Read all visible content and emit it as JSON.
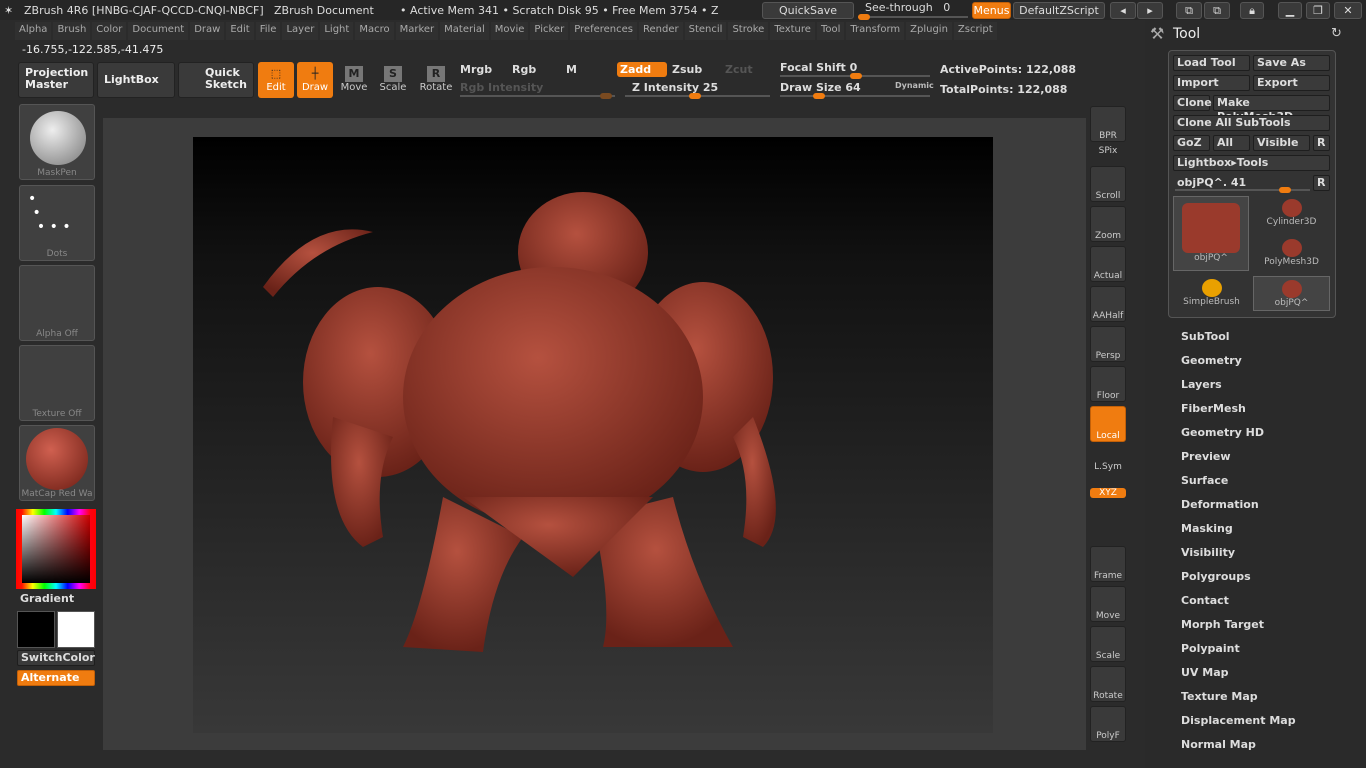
{
  "titlebar": {
    "title": "ZBrush 4R6 [HNBG-CJAF-QCCD-CNQI-NBCF]",
    "document": "ZBrush Document",
    "status": "• Active Mem 341 • Scratch Disk 95 • Free Mem 3754 • Z",
    "quicksave": "QuickSave",
    "see_through_label": "See-through",
    "see_through_value": "0",
    "see_through_level": 0,
    "menus": "Menus",
    "zscript": "DefaultZScript"
  },
  "menu": [
    "Alpha",
    "Brush",
    "Color",
    "Document",
    "Draw",
    "Edit",
    "File",
    "Layer",
    "Light",
    "Macro",
    "Marker",
    "Material",
    "Movie",
    "Picker",
    "Preferences",
    "Render",
    "Stencil",
    "Stroke",
    "Texture",
    "Tool",
    "Transform",
    "Zplugin",
    "Zscript"
  ],
  "coords": "-16.755,-122.585,-41.475",
  "toolbar": {
    "projection_master": "Projection Master",
    "lightbox": "LightBox",
    "quick_sketch": "Quick Sketch",
    "edit": "Edit",
    "draw": "Draw",
    "move": "Move",
    "scale": "Scale",
    "rotate": "Rotate",
    "mrgb": "Mrgb",
    "rgb": "Rgb",
    "m": "M",
    "rgb_intensity": "Rgb Intensity",
    "zadd": "Zadd",
    "zsub": "Zsub",
    "zcut": "Zcut",
    "z_intensity": "Z Intensity 25",
    "focal_shift": "Focal Shift 0",
    "draw_size": "Draw Size 64",
    "dynamic": "Dynamic",
    "active_points": "ActivePoints: 122,088",
    "total_points": "TotalPoints: 122,088"
  },
  "left_shelf": {
    "brush": "MaskPen",
    "stroke": "Dots",
    "alpha": "Alpha Off",
    "texture": "Texture Off",
    "material": "MatCap Red Wa",
    "gradient": "Gradient",
    "switch_color": "SwitchColor",
    "alternate": "Alternate"
  },
  "right_shelf": [
    "BPR",
    "SPix",
    "Scroll",
    "Zoom",
    "Actual",
    "AAHalf",
    "Persp",
    "Floor",
    "Local",
    "L.Sym",
    "XYZ",
    "Frame",
    "Move",
    "Scale",
    "Rotate",
    "PolyF"
  ],
  "tool_panel": {
    "title": "Tool",
    "load": "Load Tool",
    "save_as": "Save As",
    "import": "Import",
    "export": "Export",
    "clone": "Clone",
    "make_polymesh": "Make PolyMesh3D",
    "clone_all": "Clone All SubTools",
    "goz": "GoZ",
    "all": "All",
    "visible": "Visible",
    "r": "R",
    "lightbox_tools": "Lightbox▸Tools",
    "current": "objPQ^. 41",
    "thumbs": [
      "objPQ^",
      "Cylinder3D",
      "PolyMesh3D",
      "SimpleBrush",
      "objPQ^"
    ],
    "sections": [
      "SubTool",
      "Geometry",
      "Layers",
      "FiberMesh",
      "Geometry HD",
      "Preview",
      "Surface",
      "Deformation",
      "Masking",
      "Visibility",
      "Polygroups",
      "Contact",
      "Morph Target",
      "Polypaint",
      "UV Map",
      "Texture Map",
      "Displacement Map",
      "Normal Map"
    ]
  },
  "colors": {
    "accent": "#f07c10",
    "model": "#9a3a2c"
  }
}
